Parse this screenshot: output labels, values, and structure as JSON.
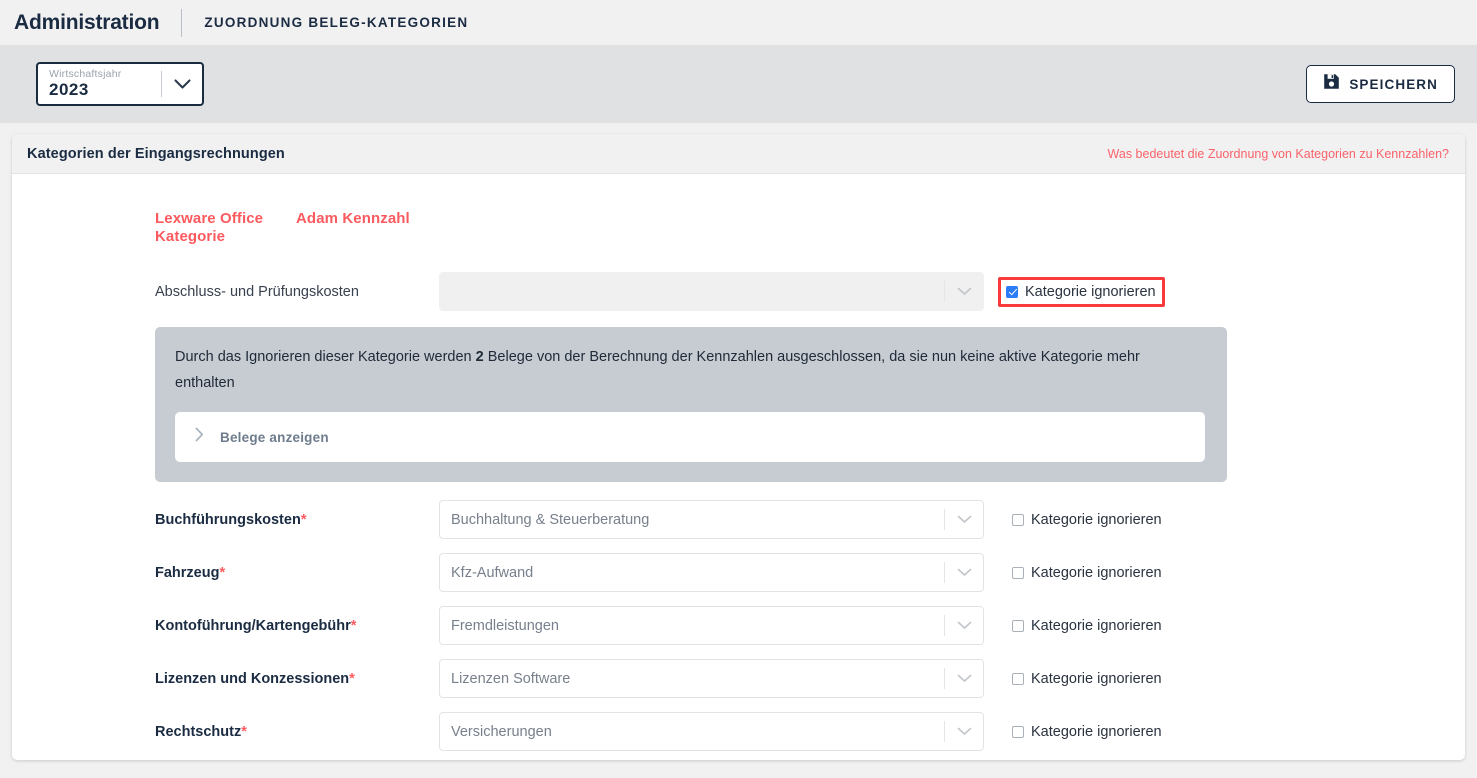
{
  "header": {
    "app_title": "Administration",
    "breadcrumb": "ZUORDNUNG BELEG-KATEGORIEN"
  },
  "toolbar": {
    "year_select": {
      "label": "Wirtschaftsjahr",
      "value": "2023",
      "arrow_icon": "chevron-down-icon"
    },
    "save_button": {
      "label": "SPEICHERN",
      "icon": "save-floppy-icon"
    }
  },
  "card": {
    "title": "Kategorien der Eingangsrechnungen",
    "help_link": "Was bedeutet die Zuordnung von Kategorien zu Kennzahlen?"
  },
  "columns": {
    "left": "Lexware Office Kategorie",
    "right": "Adam Kennzahl"
  },
  "checkbox_label": "Kategorie ignorieren",
  "rows": [
    {
      "label": "Abschluss- und Prüfungskosten",
      "required": false,
      "value": "",
      "disabled": true,
      "checked": true,
      "flagged": true
    },
    {
      "label": "Buchführungskosten",
      "required": true,
      "value": "Buchhaltung & Steuerberatung",
      "disabled": false,
      "checked": false,
      "flagged": false
    },
    {
      "label": "Fahrzeug",
      "required": true,
      "value": "Kfz-Aufwand",
      "disabled": false,
      "checked": false,
      "flagged": false
    },
    {
      "label": "Kontoführung/Kartengebühr",
      "required": true,
      "value": "Fremdleistungen",
      "disabled": false,
      "checked": false,
      "flagged": false
    },
    {
      "label": "Lizenzen und Konzessionen",
      "required": true,
      "value": "Lizenzen Software",
      "disabled": false,
      "checked": false,
      "flagged": false
    },
    {
      "label": "Rechtschutz",
      "required": true,
      "value": "Versicherungen",
      "disabled": false,
      "checked": false,
      "flagged": false
    }
  ],
  "info_panel": {
    "text_before": "Durch das Ignorieren dieser Kategorie werden ",
    "count": "2",
    "text_after": " Belege von der Berechnung der Kennzahlen ausgeschlossen, da sie nun keine aktive Kategorie mehr enthalten",
    "accordion_label": "Belege anzeigen",
    "accordion_icon": "chevron-right-icon"
  },
  "colors": {
    "accent_red": "#fb5a5f",
    "highlight_red": "#fb3b3b",
    "dark_navy": "#1a2b42",
    "checkbox_blue": "#2b7cf6",
    "info_panel_grey": "#c7ccd2"
  }
}
